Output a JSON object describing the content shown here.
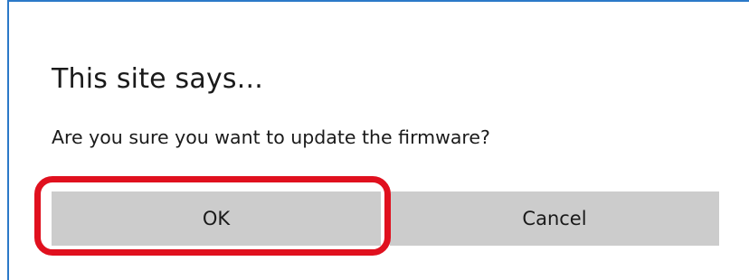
{
  "dialog": {
    "title": "This site says...",
    "message": "Are you sure you want to update the firmware?",
    "buttons": {
      "ok_label": "OK",
      "cancel_label": "Cancel"
    }
  },
  "colors": {
    "window_border": "#2b79c8",
    "button_bg": "#cccccc",
    "highlight": "#e0101e",
    "text": "#1a1a1a"
  }
}
